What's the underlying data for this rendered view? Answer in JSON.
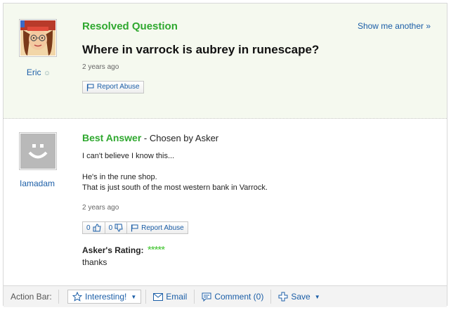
{
  "question": {
    "status_label": "Resolved Question",
    "show_another": "Show me another »",
    "title": "Where in varrock is aubrey in runescape?",
    "time_ago": "2 years ago",
    "report_abuse": "Report Abuse",
    "asker": {
      "name": "Eric",
      "avatar_icon": "avatar-cartoon-girl-icon"
    }
  },
  "answer": {
    "best_answer_label": "Best Answer",
    "chosen_by": "- Chosen by Asker",
    "lines": [
      "I can't believe I know this...",
      "",
      "He's in the rune shop.",
      "That is just south of the most western bank in Varrock."
    ],
    "time_ago": "2 years ago",
    "thumbs_up_count": "0",
    "thumbs_down_count": "0",
    "report_abuse": "Report Abuse",
    "answerer": {
      "name": "Iamadam",
      "avatar_icon": "default-smiley-avatar-icon"
    },
    "rating_label": "Asker's Rating:",
    "rating_stars": "*****",
    "rating_value": 5,
    "rating_comment": "thanks"
  },
  "action_bar": {
    "label": "Action Bar:",
    "interesting": "Interesting!",
    "email": "Email",
    "comment": "Comment (0)",
    "save": "Save"
  },
  "colors": {
    "accent_green": "#2fa82f",
    "link_blue": "#1b5ea7",
    "question_bg": "#f5f9ef",
    "star_green": "#43c532"
  }
}
